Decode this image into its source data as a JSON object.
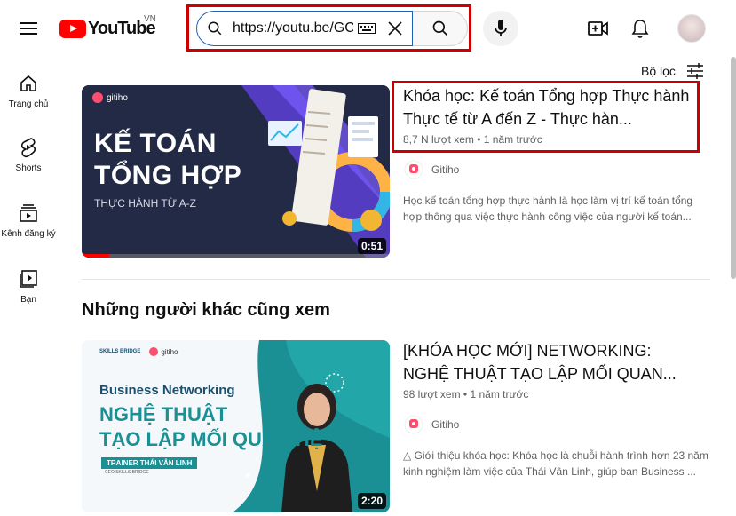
{
  "header": {
    "logo_text": "YouTube",
    "country_code": "VN",
    "search_value": "https://youtu.be/GC",
    "create_label": "Create",
    "notifications_label": "Notifications"
  },
  "sidebar": {
    "items": [
      {
        "label": "Trang chủ",
        "icon": "home-icon"
      },
      {
        "label": "Shorts",
        "icon": "shorts-icon"
      },
      {
        "label": "Kênh đăng ký",
        "icon": "subscriptions-icon"
      },
      {
        "label": "Bạn",
        "icon": "you-icon"
      }
    ]
  },
  "filter": {
    "label": "Bộ lọc",
    "icon": "filter-icon"
  },
  "results": [
    {
      "title": "Khóa học: Kế toán Tổng hợp Thực hành Thực tế từ A đến Z - Thực hàn...",
      "views": "8,7 N lượt xem",
      "age": "1 năm trước",
      "channel": "Gitiho",
      "description": "Học kế toán tổng hợp thực hành là học làm vị trí kế toán tổng hợp thông qua việc thực hành công việc của người kế toán...",
      "duration": "0:51",
      "thumb": {
        "brand": "gitiho",
        "line1": "KẾ TOÁN",
        "line2": "TỔNG HỢP",
        "line3": "THỰC HÀNH TỪ A-Z"
      },
      "watched_fraction": 0.09
    },
    {
      "title": "[KHÓA HỌC MỚI] NETWORKING: NGHỆ THUẬT TẠO LẬP MỐI QUAN...",
      "views": "98 lượt xem",
      "age": "1 năm trước",
      "channel": "Gitiho",
      "description": "△ Giới thiệu khóa học: Khóa học là chuỗi hành trình hơn 23 năm kinh nghiệm làm việc của Thái Vân Linh, giúp bạn Business ...",
      "duration": "2:20",
      "thumb": {
        "brand_left": "SKILLS BRIDGE",
        "brand": "gitiho",
        "line1": "Business Networking",
        "line2": "NGHỆ THUẬT",
        "line3": "TẠO LẬP MỐI QUAN HỆ",
        "trainer": "TRAINER THÁI VÂN LINH",
        "trainer_sub": "CEO SKILLS BRIDGE"
      }
    }
  ],
  "section_title": "Những người khác cũng xem",
  "meta_separator": " • ",
  "colors": {
    "accent_red": "#ff0000",
    "highlight_outline": "#cc0000",
    "thumb1_bg": "#232a45",
    "thumb2_teal": "#1a8f94"
  }
}
